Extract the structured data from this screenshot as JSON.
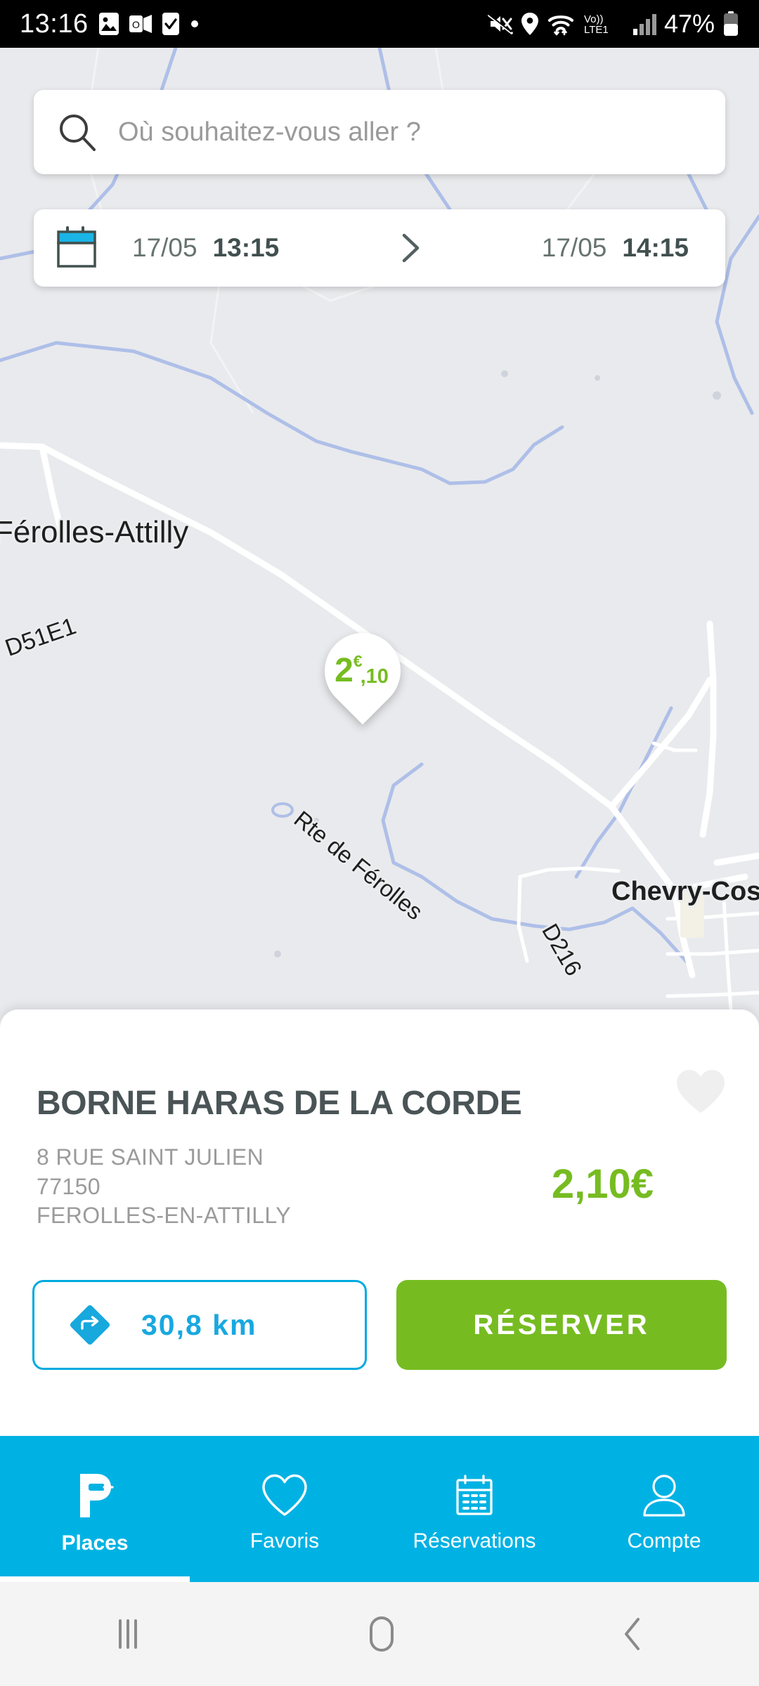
{
  "statusbar": {
    "time": "13:16",
    "battery_percent": "47%",
    "left_icons": [
      "photos-icon",
      "outlook-icon",
      "tasks-check-icon",
      "dot-indicator-icon"
    ],
    "right_icons": [
      "mute-icon",
      "location-icon",
      "wifi-icon",
      "volte-lte1-icon",
      "signal-bars-icon",
      "battery-icon"
    ],
    "network_label": "Vo))",
    "network_sub": "LTE1"
  },
  "search": {
    "placeholder": "Où souhaitez-vous aller ?",
    "value": "",
    "icon": "search-icon"
  },
  "datebar": {
    "icon": "calendar-icon",
    "start_date": "17/05",
    "start_time": "13:15",
    "separator_icon": "chevron-right-icon",
    "end_date": "17/05",
    "end_time": "14:15"
  },
  "map": {
    "pin": {
      "integer": "2",
      "currency": "€",
      "decimals": ",10",
      "color": "#76bc21"
    },
    "labels": [
      {
        "text": "Férolles-Attilly",
        "type": "locality"
      },
      {
        "text": "Chevry-Coss",
        "type": "locality"
      },
      {
        "text": "D51E1",
        "type": "road"
      },
      {
        "text": "Rte de Férolles",
        "type": "road"
      },
      {
        "text": "D216",
        "type": "road"
      }
    ]
  },
  "card": {
    "title": "BORNE HARAS DE LA CORDE",
    "favorite_icon": "heart-icon",
    "favorite_active": false,
    "address_line1": "8 RUE SAINT JULIEN",
    "address_line2": "77150",
    "address_line3": "FEROLLES-EN-ATTILLY",
    "price": "2,10€",
    "distance_label": "30,8 km",
    "distance_icon": "directions-icon",
    "reserve_label": "RÉSERVER"
  },
  "bottomnav": {
    "items": [
      {
        "label": "Places",
        "icon": "parking-plug-icon",
        "active": true
      },
      {
        "label": "Favoris",
        "icon": "heart-outline-icon",
        "active": false
      },
      {
        "label": "Réservations",
        "icon": "calendar-outline-icon",
        "active": false
      },
      {
        "label": "Compte",
        "icon": "person-outline-icon",
        "active": false
      }
    ]
  },
  "androidnav": {
    "recents_icon": "recents-icon",
    "home_icon": "home-icon",
    "back_icon": "back-icon"
  },
  "colors": {
    "accent_cyan": "#00b2e3",
    "accent_green": "#76bc21",
    "map_bg": "#e9eaed",
    "text_dark": "#4a5456",
    "text_muted": "#9b9b9b"
  }
}
